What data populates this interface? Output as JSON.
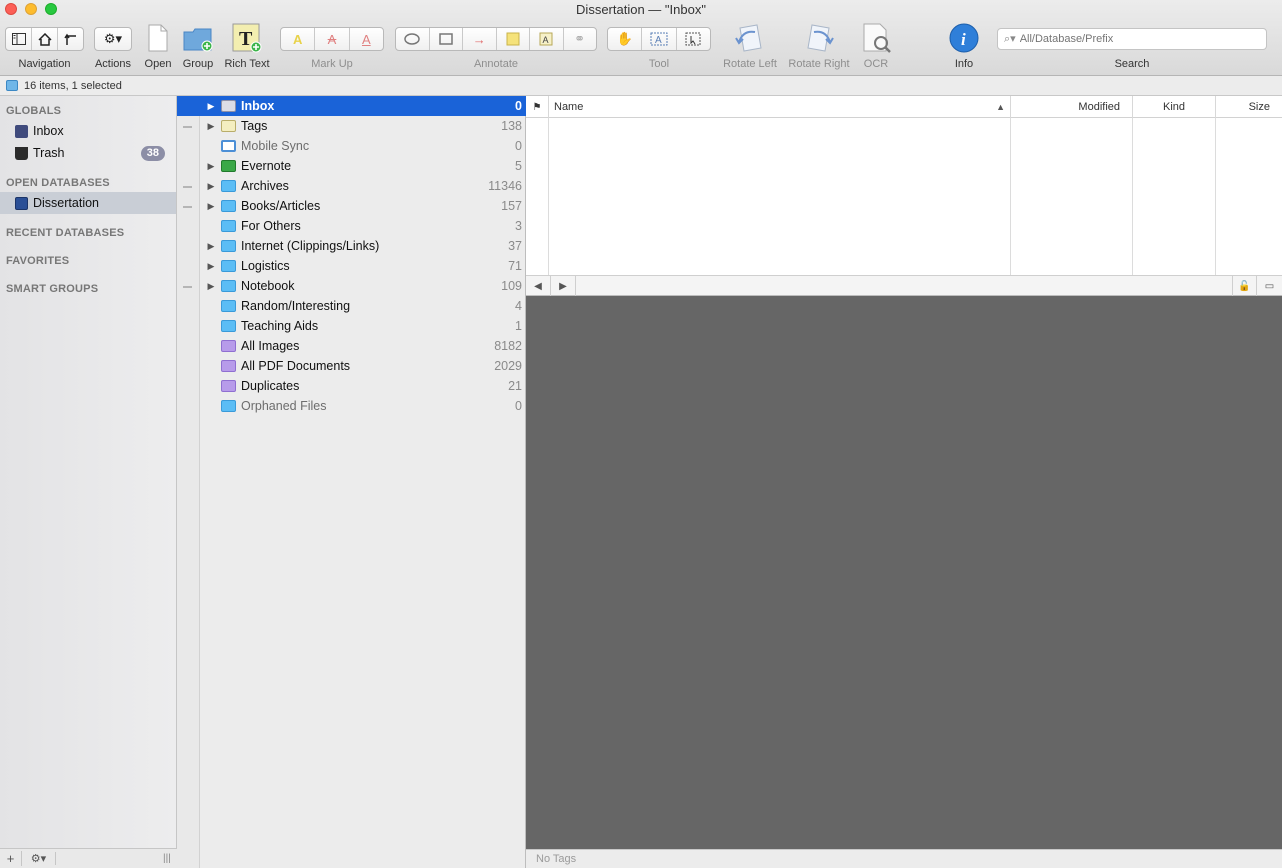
{
  "window": {
    "title": "Dissertation — \"Inbox\""
  },
  "toolbar": {
    "navigation_label": "Navigation",
    "actions_label": "Actions",
    "open_label": "Open",
    "group_label": "Group",
    "rich_text_label": "Rich Text",
    "markup_label": "Mark Up",
    "annotate_label": "Annotate",
    "tool_label": "Tool",
    "rotate_left_label": "Rotate Left",
    "rotate_right_label": "Rotate Right",
    "ocr_label": "OCR",
    "info_label": "Info",
    "search_label": "Search",
    "search_placeholder": "All/Database/Prefix"
  },
  "status": {
    "text": "16 items, 1 selected"
  },
  "sidebar": {
    "globals_head": "GLOBALS",
    "inbox": "Inbox",
    "trash": "Trash",
    "trash_count": "38",
    "open_db_head": "OPEN DATABASES",
    "dissertation": "Dissertation",
    "recent_head": "RECENT DATABASES",
    "favorites_head": "FAVORITES",
    "smart_head": "SMART GROUPS"
  },
  "groups": [
    {
      "name": "Inbox",
      "count": "0"
    },
    {
      "name": "Tags",
      "count": "138"
    },
    {
      "name": "Mobile Sync",
      "count": "0"
    },
    {
      "name": "Evernote",
      "count": "5"
    },
    {
      "name": "Archives",
      "count": "11346"
    },
    {
      "name": "Books/Articles",
      "count": "157"
    },
    {
      "name": "For Others",
      "count": "3"
    },
    {
      "name": "Internet (Clippings/Links)",
      "count": "37"
    },
    {
      "name": "Logistics",
      "count": "71"
    },
    {
      "name": "Notebook",
      "count": "109"
    },
    {
      "name": "Random/Interesting",
      "count": "4"
    },
    {
      "name": "Teaching Aids",
      "count": "1"
    },
    {
      "name": "All Images",
      "count": "8182"
    },
    {
      "name": "All PDF Documents",
      "count": "2029"
    },
    {
      "name": "Duplicates",
      "count": "21"
    },
    {
      "name": "Orphaned Files",
      "count": "0"
    }
  ],
  "filelist": {
    "col_name": "Name",
    "col_modified": "Modified",
    "col_kind": "Kind",
    "col_size": "Size"
  },
  "tagbar": {
    "text": "No Tags"
  },
  "colors": {
    "selection": "#1a63d8",
    "preview_bg": "#666666",
    "folder": "#5bbdf5",
    "smart_group": "#b79bea"
  }
}
